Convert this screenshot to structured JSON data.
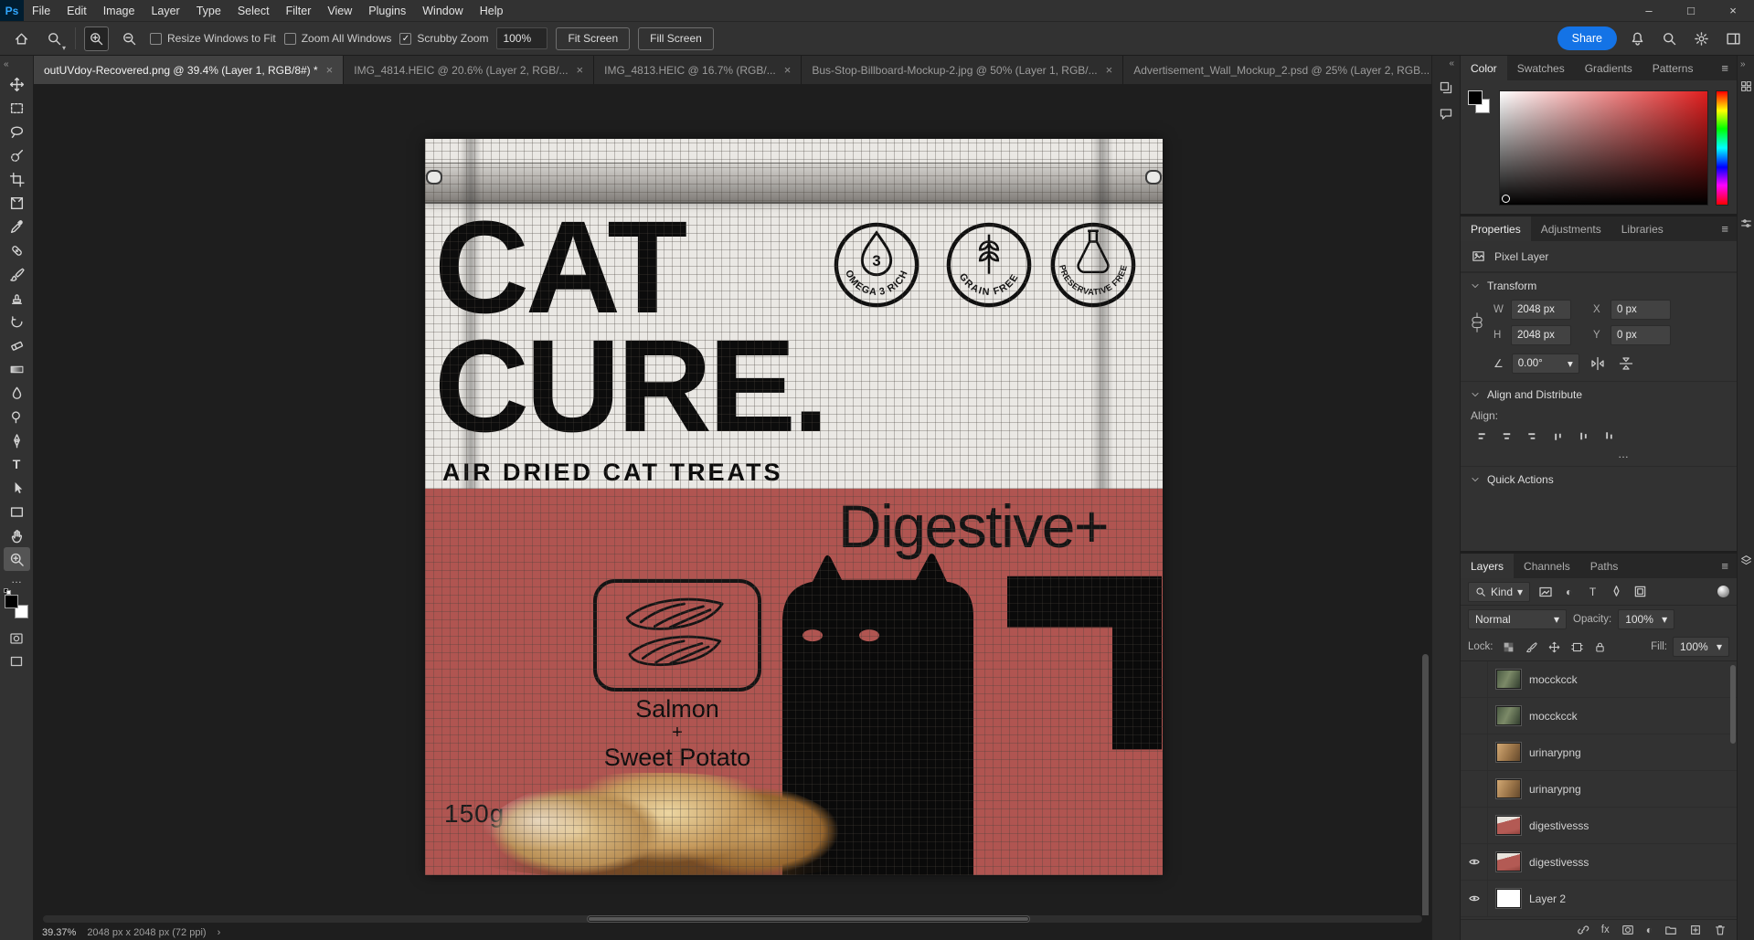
{
  "ui": {
    "close_glyph": "×",
    "check_glyph": "✓",
    "dropdown_glyph": "▾",
    "menu_glyph": "≡",
    "collapse_left": "«",
    "collapse_right": "»",
    "minimize_glyph": "–",
    "maximize_glyph": "□",
    "ellipsis_glyph": "…",
    "dots_glyph": "…",
    "status_chevron": "›",
    "type_glyph": "T",
    "adjustment_glyph": "◐",
    "angle_glyph": "∠"
  },
  "menubar": {
    "logo": "Ps",
    "items": [
      "File",
      "Edit",
      "Image",
      "Layer",
      "Type",
      "Select",
      "Filter",
      "View",
      "Plugins",
      "Window",
      "Help"
    ]
  },
  "options_bar": {
    "resize_label": "Resize Windows to Fit",
    "resize_checked": false,
    "zoom_all_label": "Zoom All Windows",
    "zoom_all_checked": false,
    "scrubby_label": "Scrubby Zoom",
    "scrubby_checked": true,
    "zoom_value": "100%",
    "fit_screen": "Fit Screen",
    "fill_screen": "Fill Screen",
    "share": "Share"
  },
  "tabs": [
    {
      "title": "outUVdoy-Recovered.png @ 39.4% (Layer 1, RGB/8#) *",
      "active": true
    },
    {
      "title": "IMG_4814.HEIC @ 20.6% (Layer 2, RGB/...",
      "active": false
    },
    {
      "title": "IMG_4813.HEIC @ 16.7% (RGB/...",
      "active": false
    },
    {
      "title": "Bus-Stop-Billboard-Mockup-2.jpg @ 50% (Layer 1, RGB/...",
      "active": false
    },
    {
      "title": "Advertisement_Wall_Mockup_2.psd @ 25% (Layer 2, RGB...",
      "active": false
    }
  ],
  "tools": {
    "active": "zoom",
    "items": [
      "move",
      "rectangular-marquee",
      "lasso",
      "quick-selection",
      "crop",
      "frame",
      "eyedropper",
      "spot-healing-brush",
      "brush",
      "clone-stamp",
      "history-brush",
      "eraser",
      "gradient",
      "blur",
      "dodge",
      "pen",
      "type",
      "path-selection",
      "rectangle",
      "hand",
      "zoom"
    ]
  },
  "canvas": {
    "package": {
      "brand1": "CAT",
      "brand2": "CURE.",
      "subtitle": "AIR DRIED CAT TREATS",
      "variant": "Digestive+",
      "flavor1": "Salmon",
      "flavor_plus": "+",
      "flavor2": "Sweet Potato",
      "weight": "150g",
      "badges": [
        {
          "label": "OMEGA 3 RICH",
          "number": "3"
        },
        {
          "label": "GRAIN FREE"
        },
        {
          "label": "PRESERVATIVE FREE"
        }
      ],
      "red": "#b05551"
    }
  },
  "panels": {
    "color": {
      "tabs": [
        "Color",
        "Swatches",
        "Gradients",
        "Patterns"
      ]
    },
    "properties": {
      "tabs": [
        "Properties",
        "Adjustments",
        "Libraries"
      ],
      "layer_type": "Pixel Layer",
      "transform_title": "Transform",
      "w_label": "W",
      "w_value": "2048 px",
      "x_label": "X",
      "x_value": "0 px",
      "h_label": "H",
      "h_value": "2048 px",
      "y_label": "Y",
      "y_value": "0 px",
      "angle_value": "0.00°",
      "align_title": "Align and Distribute",
      "align_label": "Align:",
      "quick_actions_title": "Quick Actions"
    },
    "layers": {
      "tabs": [
        "Layers",
        "Channels",
        "Paths"
      ],
      "kind_label": "Kind",
      "blend_mode": "Normal",
      "opacity_label": "Opacity:",
      "opacity_value": "100%",
      "lock_label": "Lock:",
      "fill_label": "Fill:",
      "fill_value": "100%",
      "fx_label": "fx",
      "items": [
        {
          "name": "mocckcck",
          "visible": false,
          "thumb": "green-scene"
        },
        {
          "name": "mocckcck",
          "visible": false,
          "thumb": "green-scene"
        },
        {
          "name": "urinarypng",
          "visible": false,
          "thumb": "tan-cat"
        },
        {
          "name": "urinarypng",
          "visible": false,
          "thumb": "tan-cat"
        },
        {
          "name": "digestivesss",
          "visible": false,
          "thumb": "red-package"
        },
        {
          "name": "digestivesss",
          "visible": true,
          "thumb": "red-package"
        },
        {
          "name": "Layer 2",
          "visible": true,
          "thumb": "white"
        }
      ]
    }
  },
  "status_bar": {
    "zoom": "39.37%",
    "doc_info": "2048 px x 2048 px (72 ppi)"
  },
  "colors": {
    "accent_blue": "#1473e6",
    "package_red": "#b05551",
    "ps_logo_bg": "#001d30",
    "ps_logo_fg": "#31a8ff"
  }
}
